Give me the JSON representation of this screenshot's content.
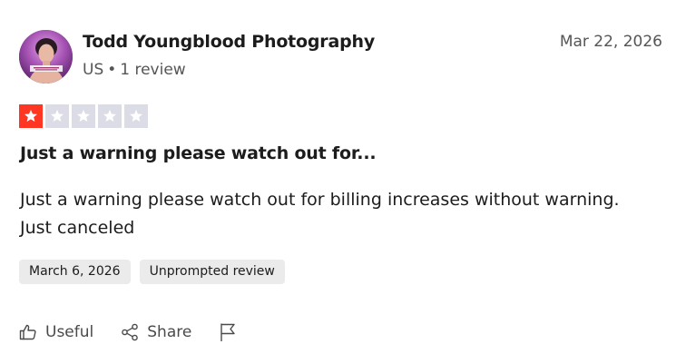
{
  "review": {
    "reviewer_name": "Todd Youngblood Photography",
    "country": "US",
    "separator": "•",
    "review_count": "1 review",
    "date": "Mar 22, 2026",
    "rating": 1,
    "rating_max": 5,
    "title": "Just a warning please watch out for...",
    "body": "Just a warning please watch out for billing increases without warning. Just canceled",
    "tags": [
      "March 6, 2026",
      "Unprompted review"
    ]
  },
  "actions": {
    "useful_label": "Useful",
    "share_label": "Share"
  },
  "icons": {
    "useful": "thumbs-up-icon",
    "share": "share-icon",
    "report": "flag-icon"
  },
  "colors": {
    "star_filled": "#ff3722",
    "star_empty": "#dcdce6",
    "tag_background": "#ebebeb",
    "text_primary": "#1c1c1c",
    "text_secondary": "#555555"
  }
}
